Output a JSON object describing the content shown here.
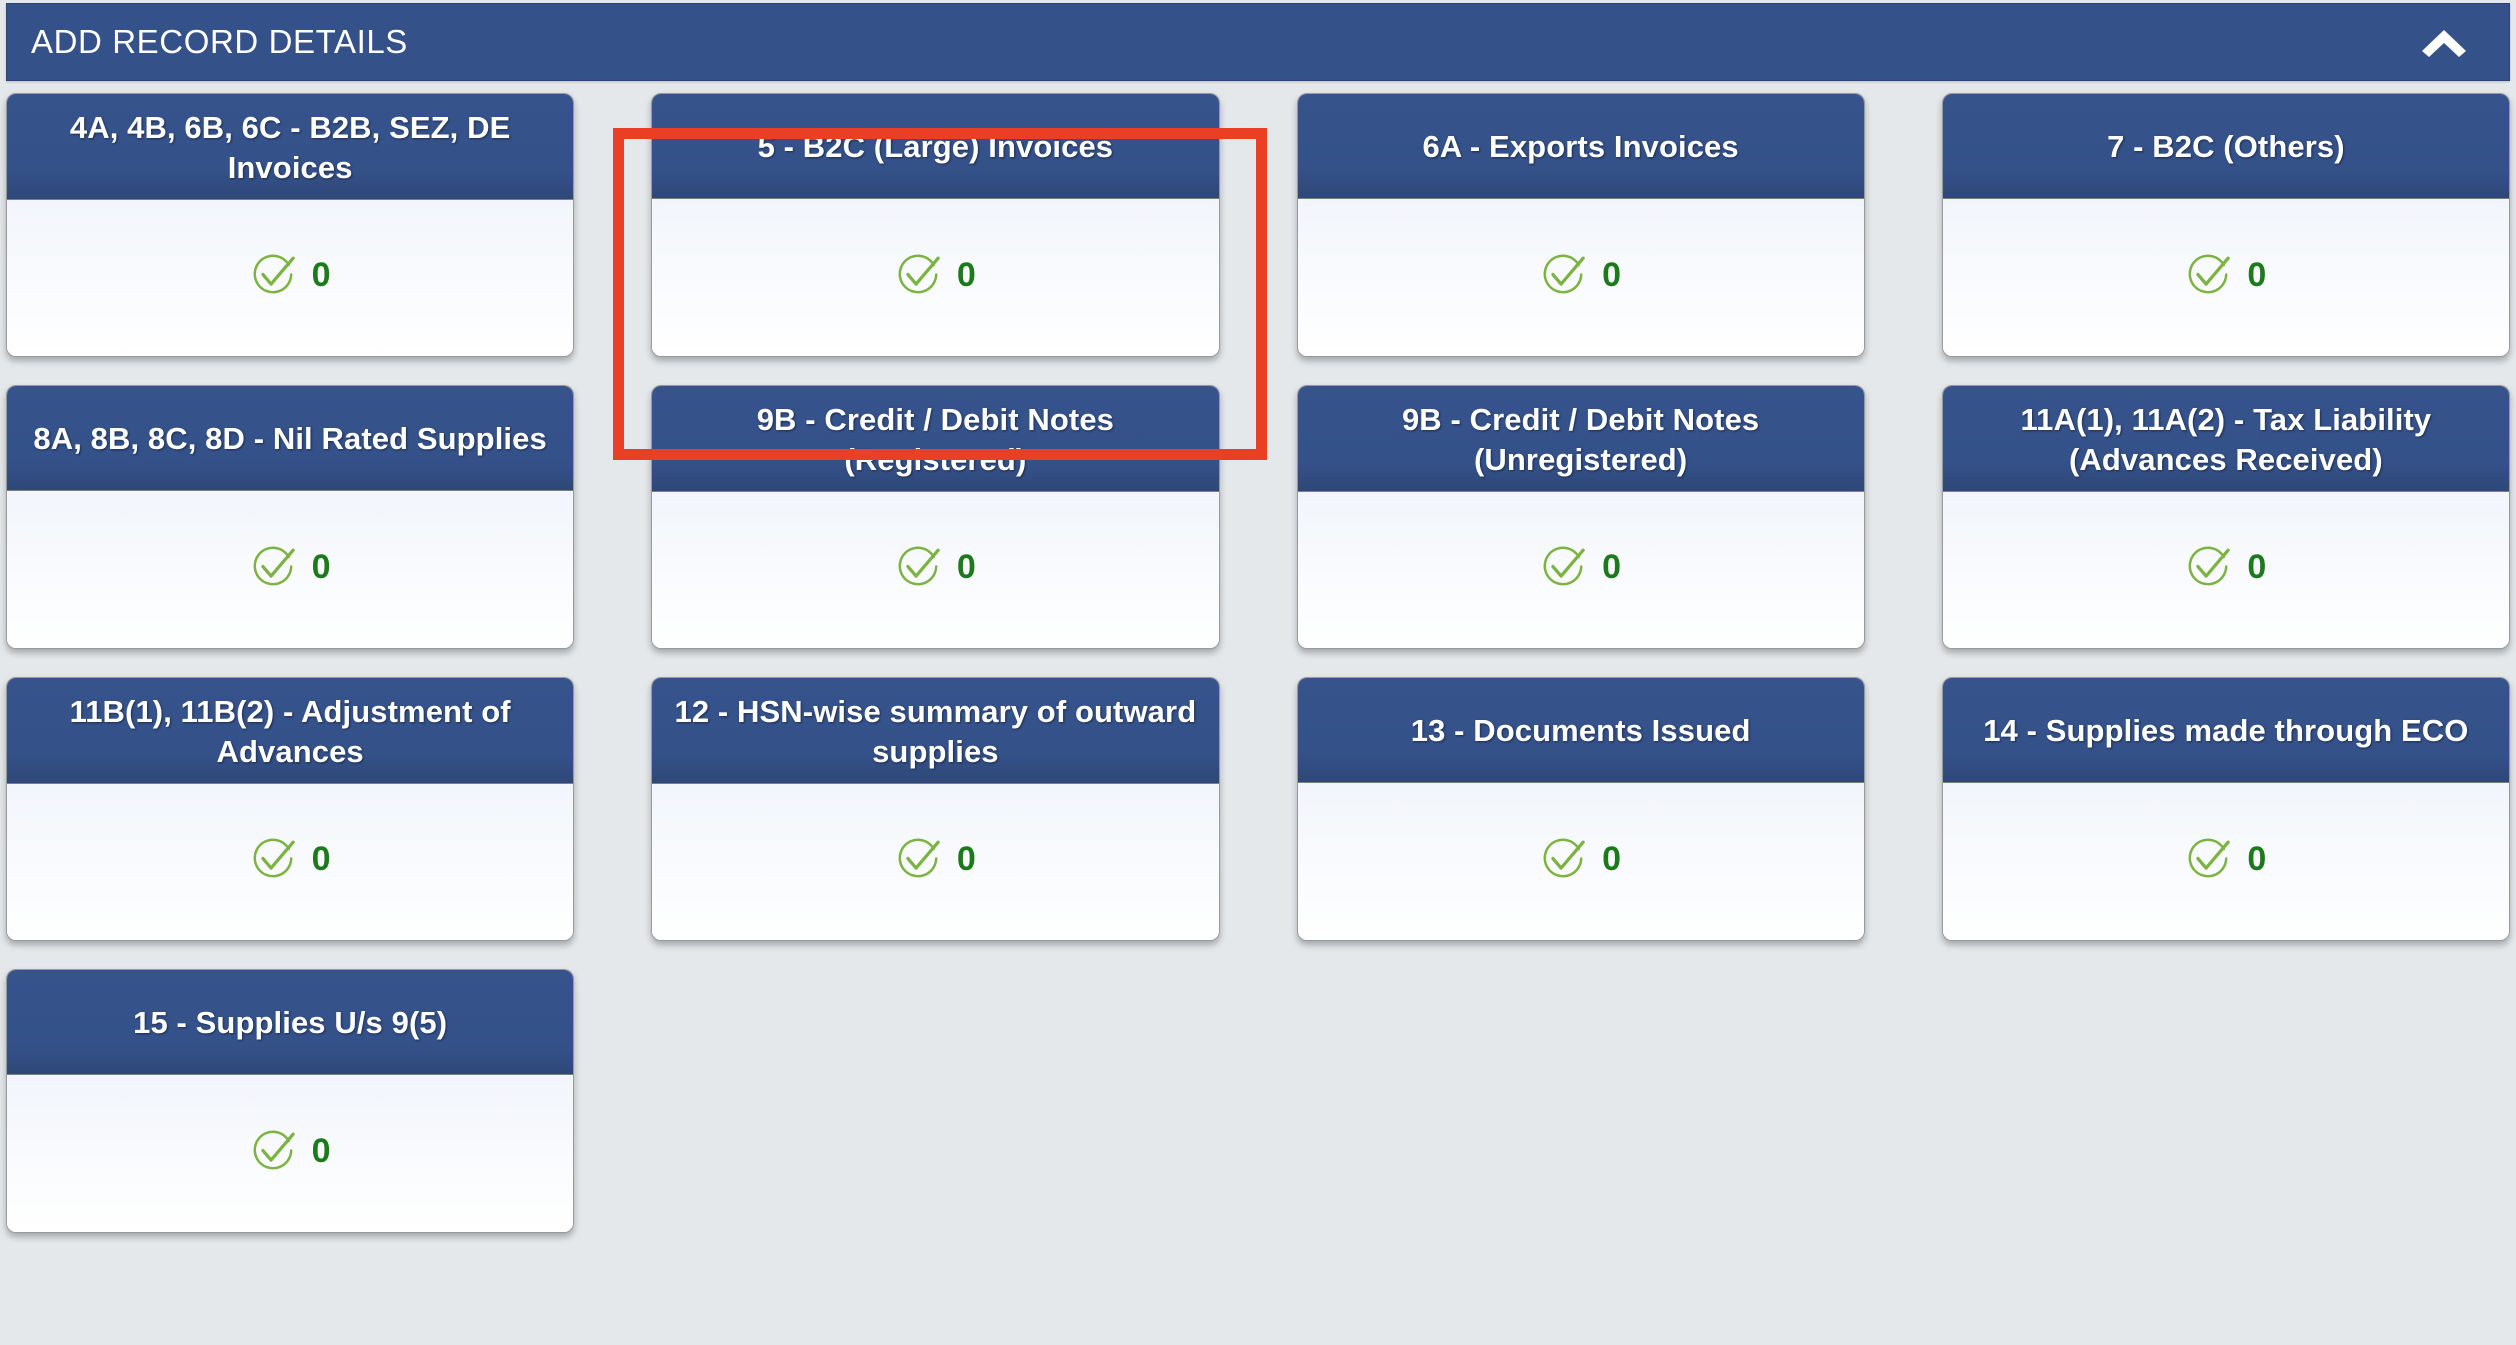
{
  "header": {
    "title": "ADD RECORD DETAILS",
    "collapse_icon": "chevron-up-icon",
    "background_color": "#34518A",
    "text_color": "#FFFFFF"
  },
  "theme": {
    "page_background": "#E4E8EB",
    "tile_header_color": "#34518A",
    "tile_body_color": "#F7FAFD",
    "count_color": "#1D7A1C",
    "check_icon_color": "#7CB342",
    "highlight_color": "#EA3F25"
  },
  "tiles": [
    {
      "title": "4A, 4B, 6B, 6C - B2B, SEZ, DE Invoices",
      "count": "0",
      "status_icon": "circle-check-icon",
      "highlighted": false
    },
    {
      "title": "5 - B2C (Large) Invoices",
      "count": "0",
      "status_icon": "circle-check-icon",
      "highlighted": true
    },
    {
      "title": "6A - Exports Invoices",
      "count": "0",
      "status_icon": "circle-check-icon",
      "highlighted": false
    },
    {
      "title": "7 - B2C (Others)",
      "count": "0",
      "status_icon": "circle-check-icon",
      "highlighted": false
    },
    {
      "title": "8A, 8B, 8C, 8D - Nil Rated Supplies",
      "count": "0",
      "status_icon": "circle-check-icon",
      "highlighted": false
    },
    {
      "title": "9B - Credit / Debit Notes (Registered)",
      "count": "0",
      "status_icon": "circle-check-icon",
      "highlighted": false
    },
    {
      "title": "9B - Credit / Debit Notes (Unregistered)",
      "count": "0",
      "status_icon": "circle-check-icon",
      "highlighted": false
    },
    {
      "title": "11A(1), 11A(2) - Tax Liability (Advances Received)",
      "count": "0",
      "status_icon": "circle-check-icon",
      "highlighted": false
    },
    {
      "title": "11B(1), 11B(2) - Adjustment of Advances",
      "count": "0",
      "status_icon": "circle-check-icon",
      "highlighted": false
    },
    {
      "title": "12 - HSN-wise summary of outward supplies",
      "count": "0",
      "status_icon": "circle-check-icon",
      "highlighted": false
    },
    {
      "title": "13 - Documents Issued",
      "count": "0",
      "status_icon": "circle-check-icon",
      "highlighted": false
    },
    {
      "title": "14 - Supplies made through ECO",
      "count": "0",
      "status_icon": "circle-check-icon",
      "highlighted": false
    },
    {
      "title": "15 - Supplies U/s 9(5)",
      "count": "0",
      "status_icon": "circle-check-icon",
      "highlighted": false
    }
  ]
}
